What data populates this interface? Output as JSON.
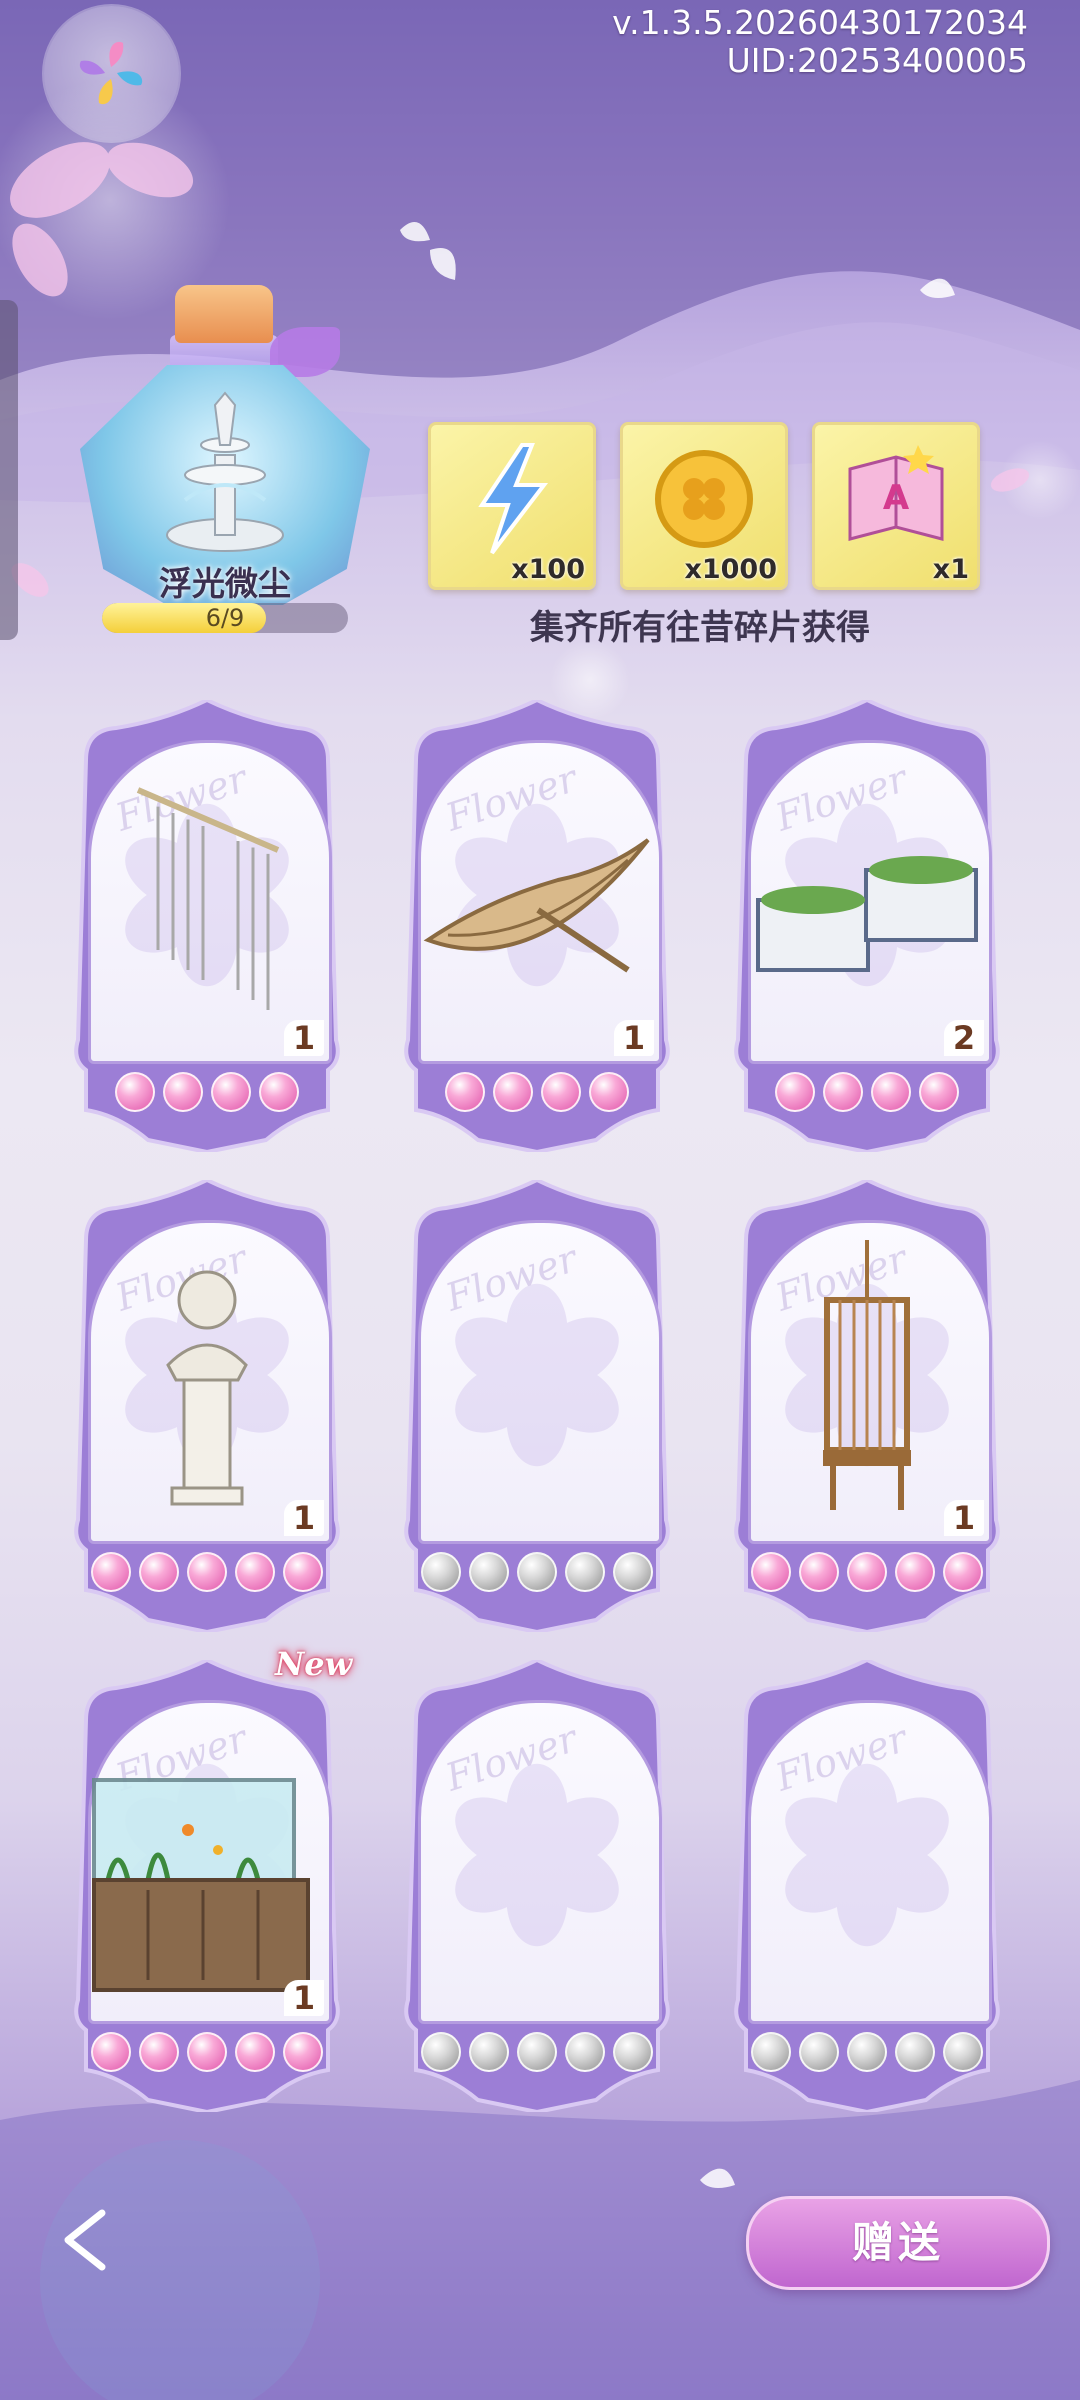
{
  "header": {
    "version": "v.1.3.5.20260430172034",
    "uid": "UID:20253400005"
  },
  "collection": {
    "name": "浮光微尘",
    "progress_text": "6/9",
    "progress_fraction": 0.667
  },
  "rewards": [
    {
      "icon": "lightning-icon",
      "count": "x100"
    },
    {
      "icon": "clover-coin-icon",
      "count": "x1000"
    },
    {
      "icon": "book-icon",
      "count": "x1"
    }
  ],
  "reward_caption": "集齐所有往昔碎片获得",
  "cards": [
    {
      "item": "wind-chime",
      "count": "1",
      "beads": [
        "pink",
        "pink",
        "pink",
        "pink"
      ],
      "watermark": "Flower"
    },
    {
      "item": "rowboat",
      "count": "1",
      "beads": [
        "pink",
        "pink",
        "pink",
        "pink"
      ],
      "watermark": "Flower"
    },
    {
      "item": "planter-boxes",
      "count": "2",
      "beads": [
        "pink",
        "pink",
        "pink",
        "pink"
      ],
      "watermark": "Flower"
    },
    {
      "item": "bust-on-pedestal",
      "count": "1",
      "beads": [
        "pink",
        "pink",
        "pink",
        "pink",
        "pink"
      ],
      "watermark": "Flower"
    },
    {
      "item": "empty",
      "count": "",
      "beads": [
        "gray",
        "gray",
        "gray",
        "gray",
        "gray"
      ],
      "watermark": "Flower"
    },
    {
      "item": "birdcage",
      "count": "1",
      "beads": [
        "pink",
        "pink",
        "pink",
        "pink",
        "pink"
      ],
      "watermark": "Flower"
    },
    {
      "item": "aquarium",
      "count": "1",
      "beads": [
        "pink",
        "pink",
        "pink",
        "pink",
        "pink"
      ],
      "watermark": "Flower"
    },
    {
      "item": "empty",
      "count": "",
      "beads": [
        "gray",
        "gray",
        "gray",
        "gray",
        "gray"
      ],
      "watermark": "Flower"
    },
    {
      "item": "empty",
      "count": "",
      "beads": [
        "gray",
        "gray",
        "gray",
        "gray",
        "gray"
      ],
      "watermark": "Flower"
    }
  ],
  "new_badge": "New",
  "footer": {
    "back_icon": "back-arrow-icon",
    "gift_label": "赠送"
  },
  "colors": {
    "accent": "#b67be6",
    "frame": "#9c7ed6",
    "progress": "#f4cf3a"
  }
}
